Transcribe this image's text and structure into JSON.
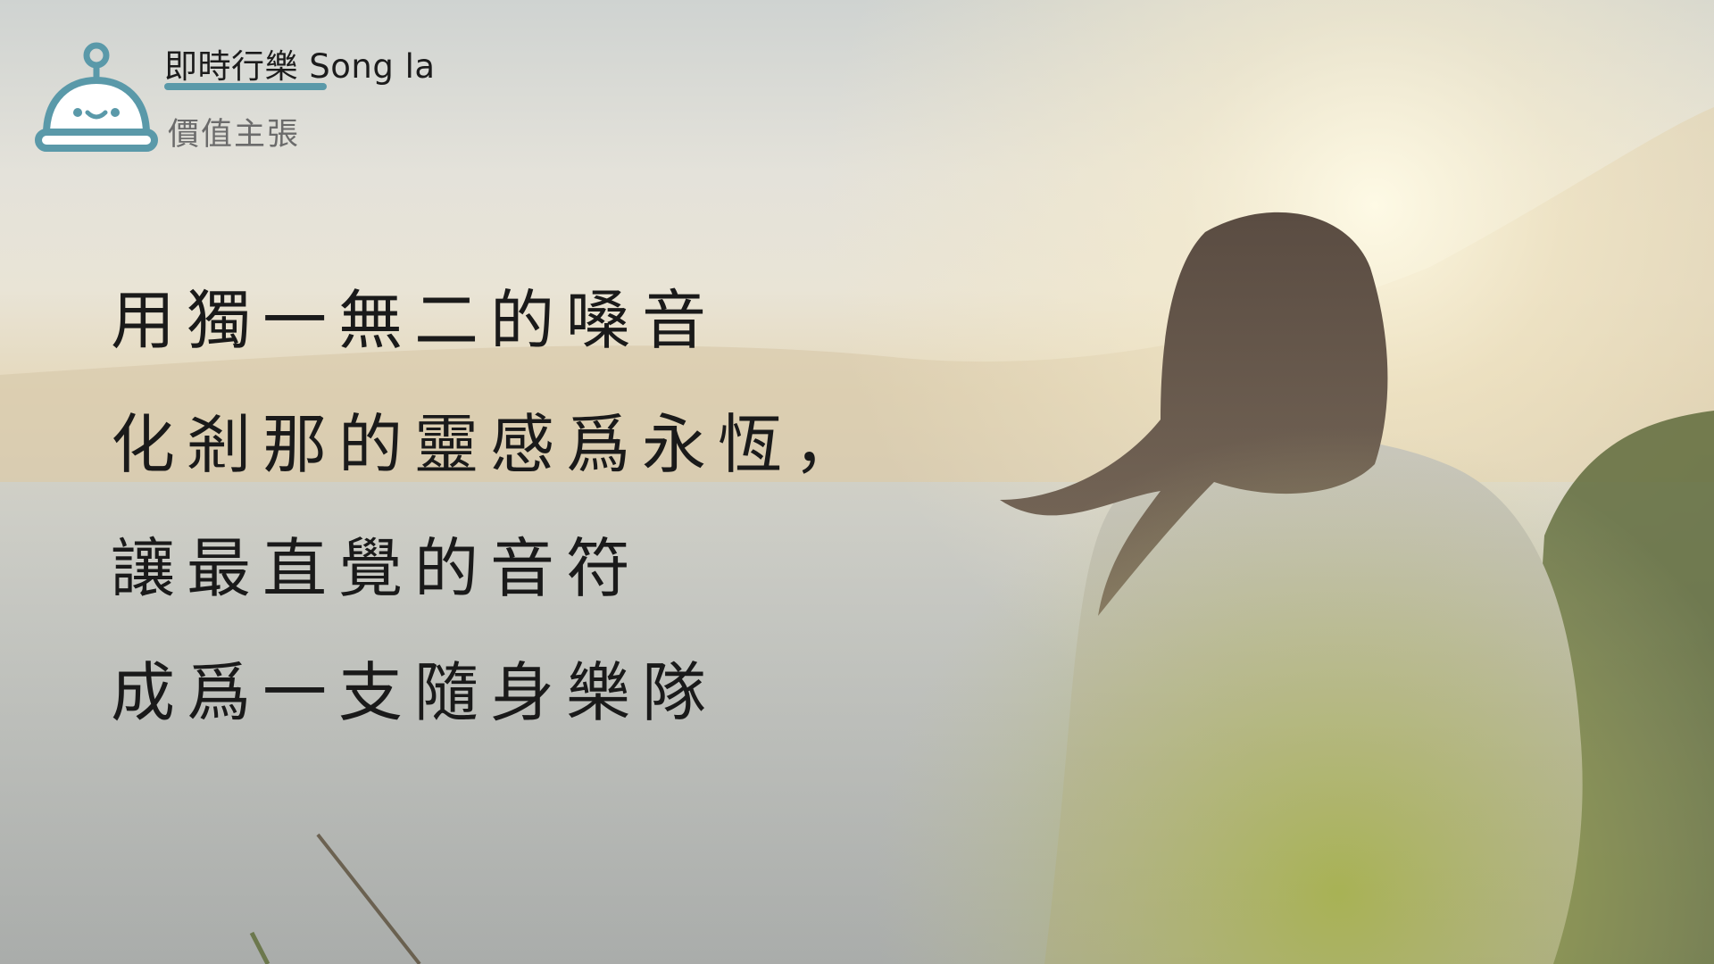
{
  "brand": {
    "title": "即時行樂 Song la",
    "subtitle": "價值主張",
    "logo_icon": "robot-bell-icon",
    "accent_color": "#5a99a9"
  },
  "statement": {
    "lines": [
      "用獨一無二的嗓音",
      "化剎那的靈感爲永恆，",
      "讓最直覺的音符",
      "成爲一支隨身樂隊"
    ]
  }
}
